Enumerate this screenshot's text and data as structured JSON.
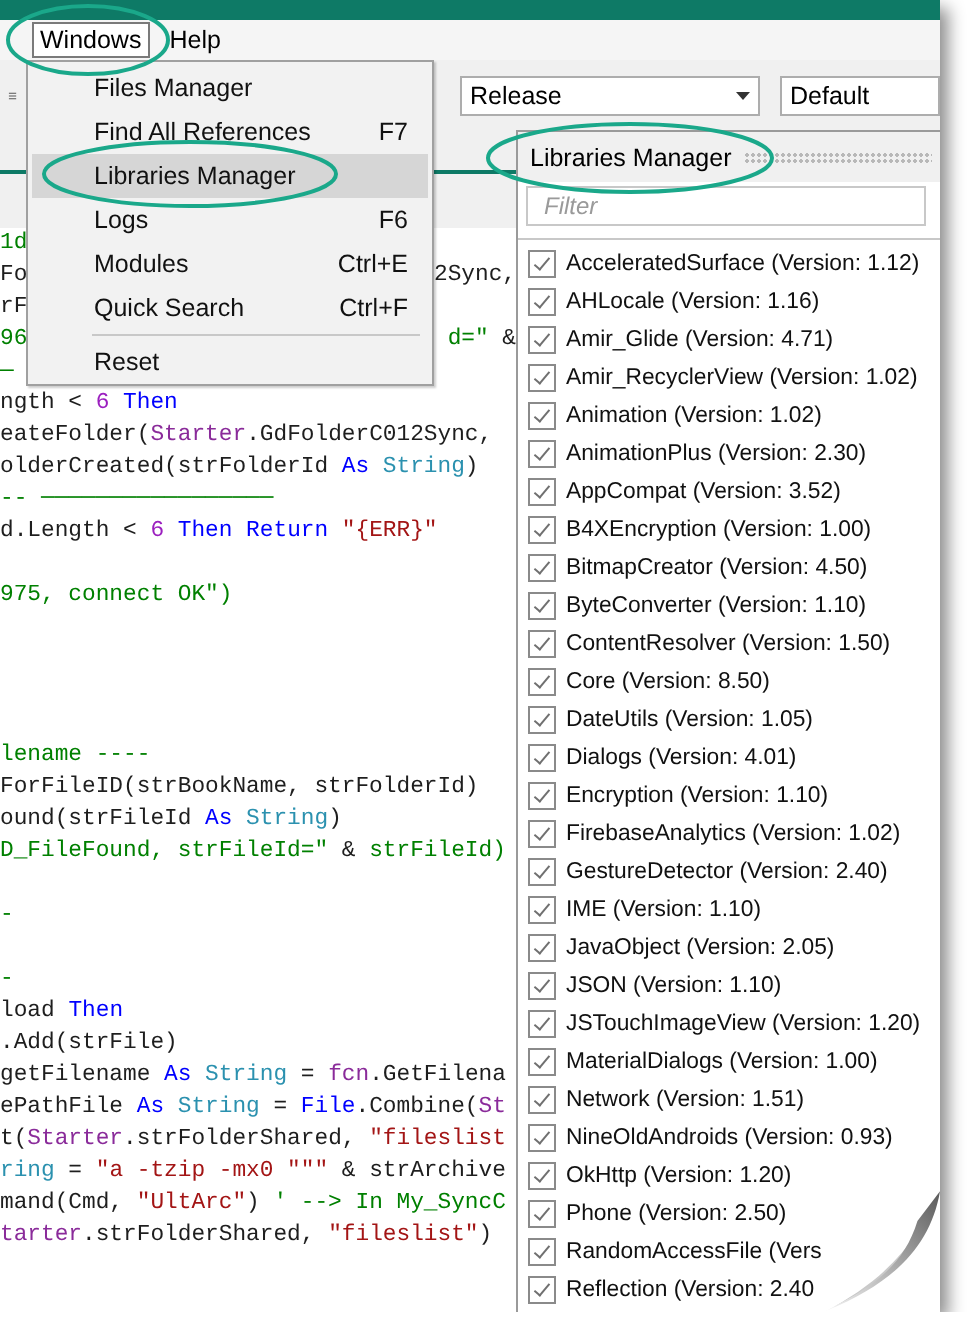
{
  "menu_bar": [
    {
      "label": "Windows",
      "selected": true
    },
    {
      "label": "Help",
      "selected": false
    }
  ],
  "toolbar": {
    "build_configuration": "Release",
    "dropdown_2": "Default"
  },
  "windows_menu": {
    "items": [
      {
        "kind": "item",
        "label": "Files Manager",
        "selected": false
      },
      {
        "kind": "item",
        "label": "Find All References",
        "shortcut": "F7",
        "selected": false
      },
      {
        "kind": "item",
        "label": "Libraries Manager",
        "selected": true
      },
      {
        "kind": "item",
        "label": "Logs",
        "shortcut": "F6",
        "selected": false
      },
      {
        "kind": "item",
        "label": "Modules",
        "shortcut": "Ctrl+E",
        "selected": false
      },
      {
        "kind": "item",
        "label": "Quick Search",
        "shortcut": "Ctrl+F",
        "selected": false
      },
      {
        "kind": "separator"
      },
      {
        "kind": "item",
        "label": "Reset",
        "selected": false
      }
    ]
  },
  "code_editor": {
    "lines": [
      {
        "kind": "code",
        "tokens": [
          {
            "t": "1d",
            "kind": "comment"
          }
        ]
      },
      {
        "kind": "code",
        "tokens": [
          {
            "t": "Fo",
            "kind": "plain"
          }
        ],
        "tail": [
          {
            "t": "2Sync,",
            "kind": "plain"
          }
        ]
      },
      {
        "kind": "code",
        "tokens": [
          {
            "t": "rF",
            "kind": "plain"
          }
        ]
      },
      {
        "kind": "code",
        "tokens": [
          {
            "t": "96",
            "kind": "comment"
          }
        ],
        "tail": [
          {
            "t": "d=\"",
            "kind": "comment"
          },
          {
            "t": " &",
            "kind": "plain"
          }
        ]
      },
      {
        "kind": "code",
        "tokens": [
          {
            "t": "—",
            "kind": "comment"
          }
        ]
      },
      {
        "kind": "code",
        "tokens": [
          {
            "t": "ngth < ",
            "kind": "plain"
          },
          {
            "t": "6",
            "kind": "number"
          },
          {
            "t": " Then",
            "kind": "keyword"
          }
        ]
      },
      {
        "kind": "code",
        "tokens": [
          {
            "t": "eateFolder(",
            "kind": "plain"
          },
          {
            "t": "Starter",
            "kind": "class"
          },
          {
            "t": ".GdFolderC012Sync,",
            "kind": "plain"
          }
        ]
      },
      {
        "kind": "code",
        "tokens": [
          {
            "t": "olderCreated(strFolderId ",
            "kind": "plain"
          },
          {
            "t": "As",
            "kind": "keyword"
          },
          {
            "t": " String",
            "kind": "type"
          },
          {
            "t": ")",
            "kind": "plain"
          }
        ]
      },
      {
        "kind": "code",
        "tokens": [
          {
            "t": "-- ─────────────────",
            "kind": "comment"
          }
        ]
      },
      {
        "kind": "code",
        "tokens": [
          {
            "t": "d.Length < ",
            "kind": "plain"
          },
          {
            "t": "6",
            "kind": "number"
          },
          {
            "t": " Then Return",
            "kind": "keyword"
          },
          {
            "t": " \"{ERR}\"",
            "kind": "string"
          }
        ]
      },
      {
        "kind": "blank"
      },
      {
        "kind": "code",
        "tokens": [
          {
            "t": "975, connect OK\")",
            "kind": "comment"
          }
        ]
      },
      {
        "kind": "blank"
      },
      {
        "kind": "blank"
      },
      {
        "kind": "blank"
      },
      {
        "kind": "blank"
      },
      {
        "kind": "code",
        "tokens": [
          {
            "t": "lename ----",
            "kind": "comment"
          }
        ]
      },
      {
        "kind": "code",
        "tokens": [
          {
            "t": "ForFileID(strBookName, strFolderId)",
            "kind": "plain"
          }
        ]
      },
      {
        "kind": "code",
        "tokens": [
          {
            "t": "ound(strFileId ",
            "kind": "plain"
          },
          {
            "t": "As",
            "kind": "keyword"
          },
          {
            "t": " String",
            "kind": "type"
          },
          {
            "t": ")",
            "kind": "plain"
          }
        ]
      },
      {
        "kind": "code",
        "tokens": [
          {
            "t": "D_FileFound, strFileId=\" ",
            "kind": "comment"
          },
          {
            "t": "&",
            "kind": "plain"
          },
          {
            "t": " strFileId)",
            "kind": "comment"
          }
        ]
      },
      {
        "kind": "blank"
      },
      {
        "kind": "code",
        "tokens": [
          {
            "t": "-",
            "kind": "comment"
          }
        ]
      },
      {
        "kind": "blank"
      },
      {
        "kind": "code",
        "tokens": [
          {
            "t": "-",
            "kind": "comment"
          }
        ]
      },
      {
        "kind": "code",
        "tokens": [
          {
            "t": "load ",
            "kind": "plain"
          },
          {
            "t": "Then",
            "kind": "keyword"
          }
        ]
      },
      {
        "kind": "code",
        "tokens": [
          {
            "t": ".Add(strFile)",
            "kind": "plain"
          }
        ]
      },
      {
        "kind": "code",
        "tokens": [
          {
            "t": "getFilename ",
            "kind": "plain"
          },
          {
            "t": "As",
            "kind": "keyword"
          },
          {
            "t": " String",
            "kind": "type"
          },
          {
            "t": " = ",
            "kind": "plain"
          },
          {
            "t": "fcn",
            "kind": "class"
          },
          {
            "t": ".GetFilena",
            "kind": "plain"
          }
        ]
      },
      {
        "kind": "code",
        "tokens": [
          {
            "t": "ePathFile ",
            "kind": "plain"
          },
          {
            "t": "As",
            "kind": "keyword"
          },
          {
            "t": " String",
            "kind": "type"
          },
          {
            "t": " = ",
            "kind": "plain"
          },
          {
            "t": "File",
            "kind": "keyword"
          },
          {
            "t": ".Combine(",
            "kind": "plain"
          },
          {
            "t": "St",
            "kind": "class"
          }
        ]
      },
      {
        "kind": "code",
        "tokens": [
          {
            "t": "t(",
            "kind": "plain"
          },
          {
            "t": "Starter",
            "kind": "class"
          },
          {
            "t": ".strFolderShared, ",
            "kind": "plain"
          },
          {
            "t": "\"fileslist",
            "kind": "string"
          }
        ]
      },
      {
        "kind": "code",
        "tokens": [
          {
            "t": "ring",
            "kind": "type"
          },
          {
            "t": " = ",
            "kind": "plain"
          },
          {
            "t": "\"a -tzip -mx0 \"\"\"",
            "kind": "string"
          },
          {
            "t": " & strArchive",
            "kind": "plain"
          }
        ]
      },
      {
        "kind": "code",
        "tokens": [
          {
            "t": "mand(Cmd, ",
            "kind": "plain"
          },
          {
            "t": "\"UltArc\"",
            "kind": "string"
          },
          {
            "t": ") ",
            "kind": "plain"
          },
          {
            "t": "' --> In My_SyncC",
            "kind": "comment"
          }
        ]
      },
      {
        "kind": "code",
        "tokens": [
          {
            "t": "tarter",
            "kind": "class"
          },
          {
            "t": ".strFolderShared, ",
            "kind": "plain"
          },
          {
            "t": "\"fileslist\"",
            "kind": "string"
          },
          {
            "t": ")",
            "kind": "plain"
          }
        ]
      }
    ]
  },
  "libraries_manager": {
    "title": "Libraries Manager",
    "filter_placeholder": "Filter",
    "libraries": [
      {
        "name": "AcceleratedSurface (Version: 1.12)",
        "checked": true
      },
      {
        "name": "AHLocale (Version: 1.16)",
        "checked": true
      },
      {
        "name": "Amir_Glide (Version: 4.71)",
        "checked": true
      },
      {
        "name": "Amir_RecyclerView (Version: 1.02)",
        "checked": true
      },
      {
        "name": "Animation (Version: 1.02)",
        "checked": true
      },
      {
        "name": "AnimationPlus (Version: 2.30)",
        "checked": true
      },
      {
        "name": "AppCompat (Version: 3.52)",
        "checked": true
      },
      {
        "name": "B4XEncryption (Version: 1.00)",
        "checked": true
      },
      {
        "name": "BitmapCreator (Version: 4.50)",
        "checked": true
      },
      {
        "name": "ByteConverter (Version: 1.10)",
        "checked": true
      },
      {
        "name": "ContentResolver (Version: 1.50)",
        "checked": true
      },
      {
        "name": "Core (Version: 8.50)",
        "checked": true
      },
      {
        "name": "DateUtils (Version: 1.05)",
        "checked": true
      },
      {
        "name": "Dialogs (Version: 4.01)",
        "checked": true
      },
      {
        "name": "Encryption (Version: 1.10)",
        "checked": true
      },
      {
        "name": "FirebaseAnalytics (Version: 1.02)",
        "checked": true
      },
      {
        "name": "GestureDetector (Version: 2.40)",
        "checked": true
      },
      {
        "name": "IME (Version: 1.10)",
        "checked": true
      },
      {
        "name": "JavaObject (Version: 2.05)",
        "checked": true
      },
      {
        "name": "JSON (Version: 1.10)",
        "checked": true
      },
      {
        "name": "JSTouchImageView (Version: 1.20)",
        "checked": true
      },
      {
        "name": "MaterialDialogs (Version: 1.00)",
        "checked": true
      },
      {
        "name": "Network (Version: 1.51)",
        "checked": true
      },
      {
        "name": "NineOldAndroids (Version: 0.93)",
        "checked": true
      },
      {
        "name": "OkHttp (Version: 1.20)",
        "checked": true
      },
      {
        "name": "Phone (Version: 2.50)",
        "checked": true
      },
      {
        "name": "RandomAccessFile (Vers",
        "checked": true
      },
      {
        "name": "Reflection (Version: 2.40",
        "checked": true
      }
    ]
  }
}
